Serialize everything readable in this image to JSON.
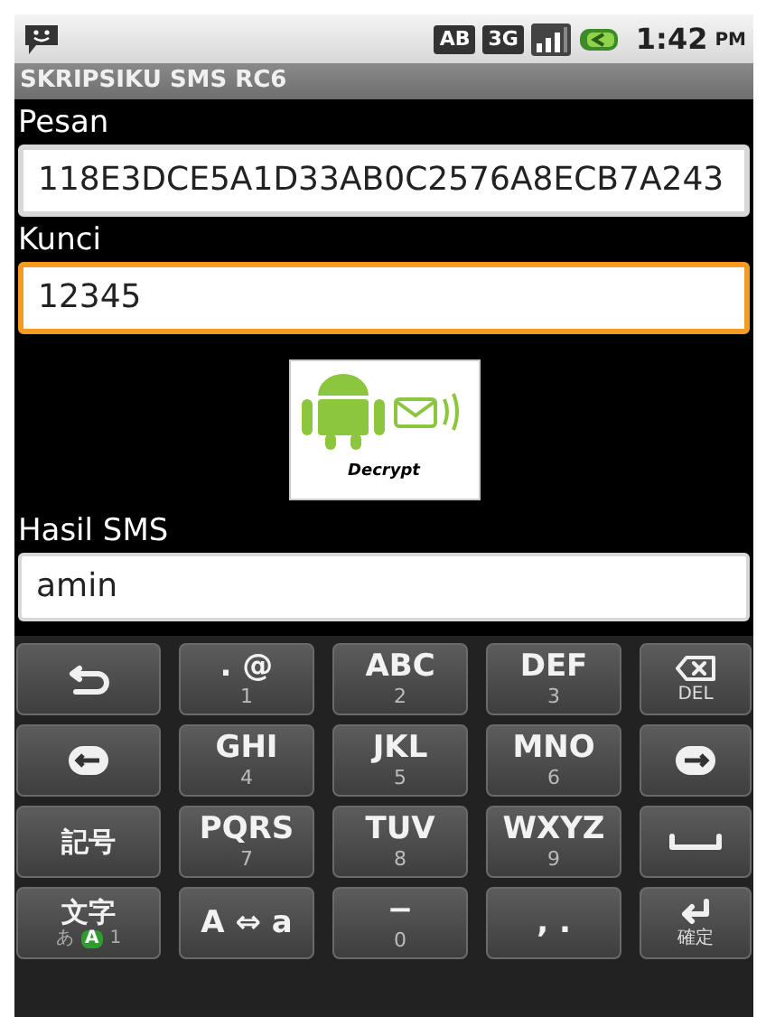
{
  "status_bar": {
    "badges": [
      "AB",
      "3G"
    ],
    "time": "1:42",
    "meridiem": "PM"
  },
  "app_title": "SKRIPSIKU SMS RC6",
  "fields": [
    {
      "label": "Pesan",
      "value": "118E3DCE5A1D33AB0C2576A8ECB7A243",
      "focused": false
    },
    {
      "label": "Kunci",
      "value": "12345",
      "focused": true
    }
  ],
  "decrypt_button": {
    "label": "Decrypt"
  },
  "result": {
    "label": "Hasil SMS",
    "value": "amin"
  },
  "keyboard": [
    [
      {
        "kind": "back"
      },
      {
        "kind": "text",
        "main": ". @",
        "sub": "1"
      },
      {
        "kind": "text",
        "main": "ABC",
        "sub": "2"
      },
      {
        "kind": "text",
        "main": "DEF",
        "sub": "3"
      },
      {
        "kind": "delete",
        "sub": "DEL"
      }
    ],
    [
      {
        "kind": "left"
      },
      {
        "kind": "text",
        "main": "GHI",
        "sub": "4"
      },
      {
        "kind": "text",
        "main": "JKL",
        "sub": "5"
      },
      {
        "kind": "text",
        "main": "MNO",
        "sub": "6"
      },
      {
        "kind": "right"
      }
    ],
    [
      {
        "kind": "text",
        "main": "記号"
      },
      {
        "kind": "text",
        "main": "PQRS",
        "sub": "7"
      },
      {
        "kind": "text",
        "main": "TUV",
        "sub": "8"
      },
      {
        "kind": "text",
        "main": "WXYZ",
        "sub": "9"
      },
      {
        "kind": "space"
      }
    ],
    [
      {
        "kind": "mode",
        "main": "文字",
        "modes": [
          {
            "label": "あ",
            "selected": false
          },
          {
            "label": "A",
            "selected": true
          },
          {
            "label": "1",
            "selected": false
          }
        ]
      },
      {
        "kind": "text",
        "main": "A ⇔ a"
      },
      {
        "kind": "text",
        "main": "−",
        "sub": "0"
      },
      {
        "kind": "text",
        "main": ", ."
      },
      {
        "kind": "enter",
        "sub": "確定"
      }
    ]
  ]
}
